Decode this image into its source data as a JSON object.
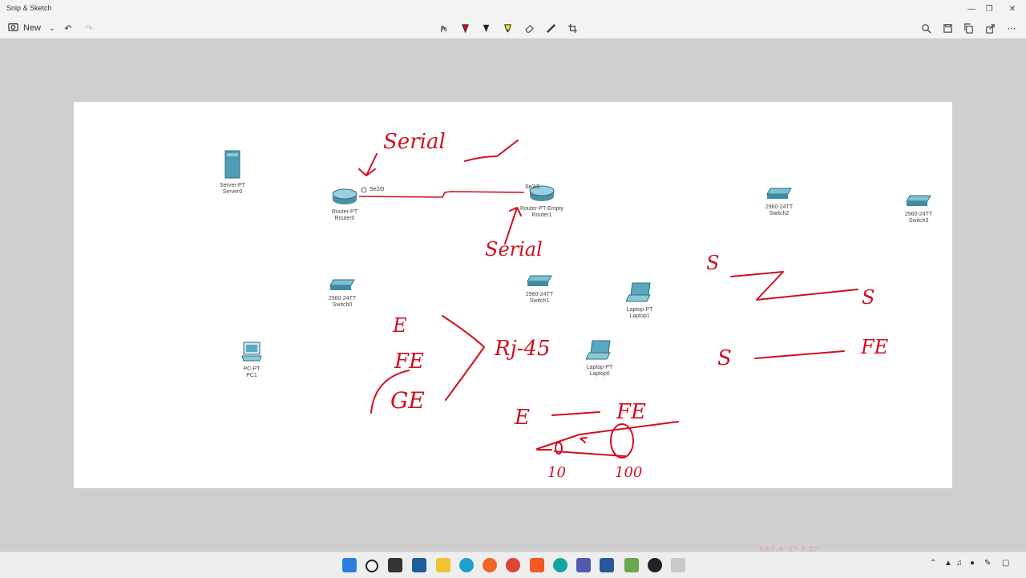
{
  "window": {
    "title": "Snip & Sketch"
  },
  "toolbar": {
    "new_label": "New"
  },
  "colors": {
    "ink": "#d10f1f",
    "accent": "#1a6fc9"
  },
  "devices": [
    {
      "name": "server",
      "line1": "Server-PT",
      "line2": "Server0"
    },
    {
      "name": "router0",
      "line1": "Router-PT",
      "line2": "Router0"
    },
    {
      "name": "router1",
      "line1": "Router-PT-Empty",
      "line2": "Router1"
    },
    {
      "name": "switch2",
      "line1": "2960-24TT",
      "line2": "Switch2"
    },
    {
      "name": "switch3",
      "line1": "2960-24TT",
      "line2": "Switch3"
    },
    {
      "name": "switch0",
      "line1": "2960-24TT",
      "line2": "Switch0"
    },
    {
      "name": "switch1",
      "line1": "2960-24TT",
      "line2": "Switch1"
    },
    {
      "name": "laptop1",
      "line1": "Laptop-PT",
      "line2": "Laptop1"
    },
    {
      "name": "laptop0",
      "line1": "Laptop-PT",
      "line2": "Laptop0"
    },
    {
      "name": "pc1",
      "line1": "PC-PT",
      "line2": "PC1"
    }
  ],
  "ports": {
    "router0": "Se2/0",
    "router1": "Se2/0"
  },
  "handwriting": {
    "serial_top": "Serial",
    "serial_bottom": "Serial",
    "e": "E",
    "fe": "FE",
    "ge": "GE",
    "rj45": "Rj-45",
    "s1": "S",
    "s2": "S",
    "s3": "S",
    "fe_right": "FE",
    "e2": "E",
    "fe2": "FE",
    "ten": "10",
    "hundred": "100"
  },
  "taskbar": {
    "icons": [
      "windows-start-icon",
      "search-icon",
      "task-view-icon",
      "widgets-icon",
      "file-explorer-icon",
      "edge-icon",
      "firefox-icon",
      "chrome-icon",
      "brave-icon",
      "whiteboard-icon",
      "teams-icon",
      "word-icon",
      "packet-tracer-icon",
      "obs-icon",
      "snip-sketch-icon"
    ]
  },
  "watermark": "WASIF"
}
